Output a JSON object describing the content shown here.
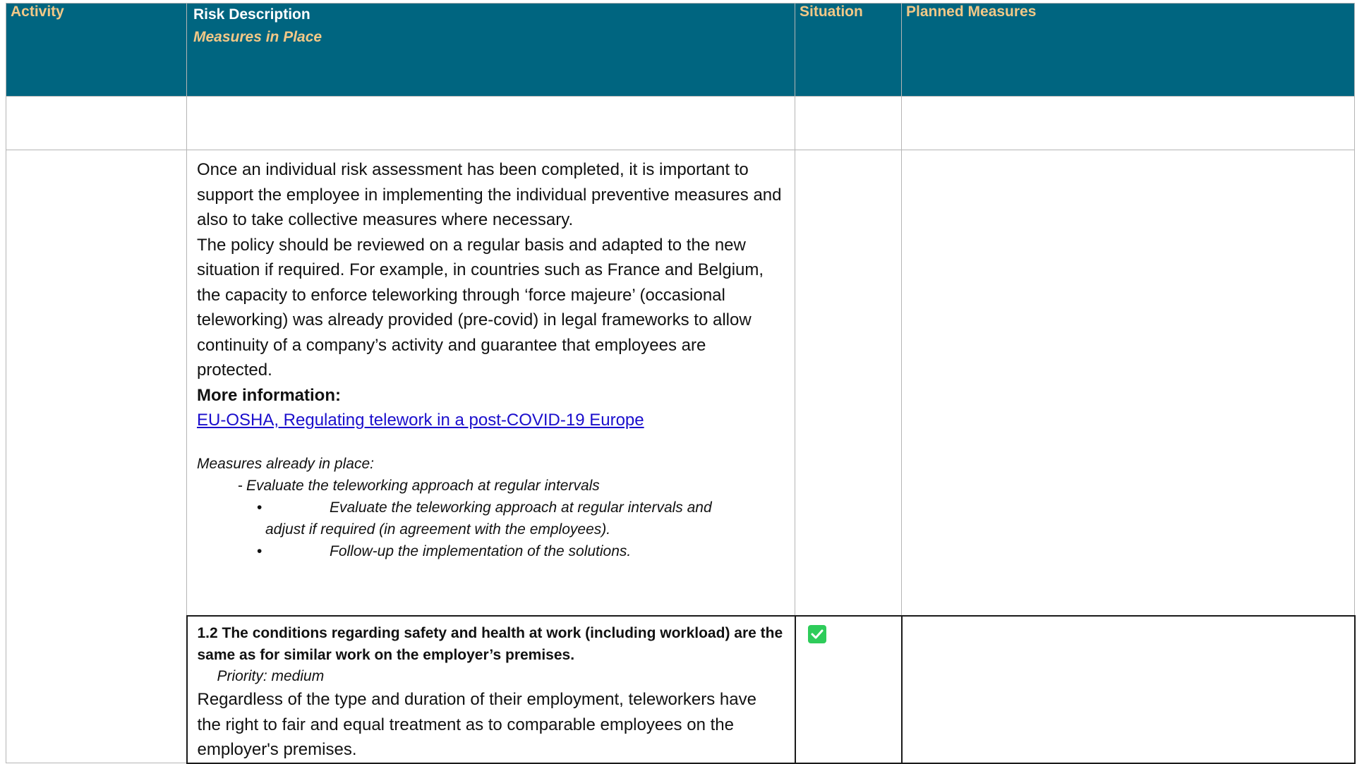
{
  "header": {
    "activity": "Activity",
    "risk_description": "Risk Description",
    "measures_in_place": "Measures in Place",
    "situation": "Situation",
    "planned_measures": "Planned Measures"
  },
  "row_main": {
    "paragraph1": "Once an individual risk assessment has been completed, it is important to support the employee in implementing the individual preventive measures and also to take collective measures where necessary.",
    "paragraph2": "The policy should be reviewed on a regular basis and adapted to the new situation if required. For example, in countries such as France and Belgium, the capacity to enforce teleworking through ‘force majeure’ (occasional teleworking) was already provided (pre-covid) in legal frameworks to allow continuity of a company’s activity and guarantee that employees are protected.",
    "more_info_label": "More information:",
    "link_text": "EU-OSHA, Regulating telework in a post-COVID-19 Europe",
    "measures_label": "Measures already in place:",
    "measure_dash": "Evaluate the teleworking approach at regular intervals",
    "bullet_char": "•",
    "bullet1_line1": "Evaluate the teleworking approach at regular intervals and",
    "bullet1_line2": "adjust if required (in agreement with the employees).",
    "bullet2": "Follow-up the implementation of the solutions."
  },
  "section_1_2": {
    "title": "1.2 The conditions regarding safety and health at work (including workload) are the same as for similar work on the employer’s premises.",
    "priority": "Priority: medium",
    "body": "Regardless of the type and duration of their employment, teleworkers have the right to fair and equal treatment as to comparable employees on the employer's premises.",
    "situation_checked": true,
    "check_color": "#2ecc5a"
  },
  "colors": {
    "header_bg": "#006580",
    "header_accent": "#f2c887",
    "link": "#1a0dcc"
  }
}
